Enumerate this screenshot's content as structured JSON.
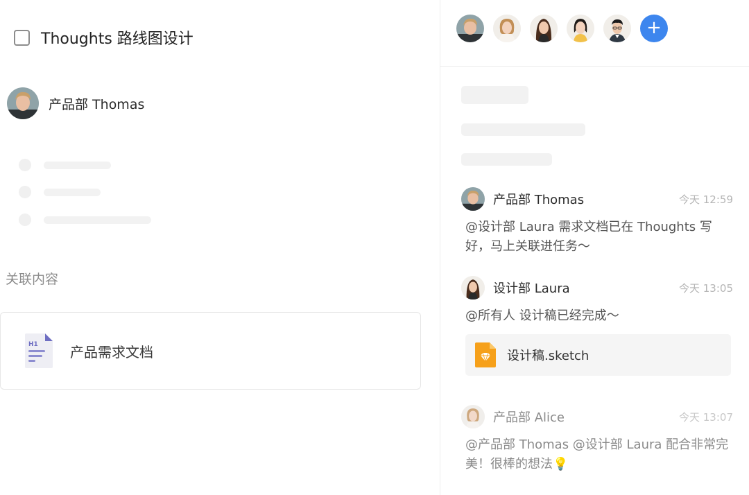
{
  "task": {
    "title": "Thoughts 路线图设计",
    "checked": false,
    "assignee": "产品部 Thomas"
  },
  "related": {
    "label": "关联内容",
    "items": [
      {
        "title": "产品需求文档",
        "icon": "h1-document-icon"
      }
    ]
  },
  "members": {
    "avatars": [
      "avatar-thomas",
      "avatar-alice",
      "avatar-laura",
      "avatar-member-4",
      "avatar-member-5"
    ],
    "add_icon": "+"
  },
  "messages": [
    {
      "author": "产品部 Thomas",
      "time": "今天 12:59",
      "text": "@设计部 Laura 需求文档已在 Thoughts 写好，马上关联进任务～"
    },
    {
      "author": "设计部 Laura",
      "time": "今天 13:05",
      "text": "@所有人 设计稿已经完成～",
      "attachment": {
        "name": "设计稿.sketch",
        "icon": "sketch-file-icon"
      }
    },
    {
      "author": "产品部 Alice",
      "time": "今天 13:07",
      "text": "@产品部 Thomas @设计部 Laura 配合非常完美！很棒的想法💡"
    }
  ],
  "colors": {
    "accent": "#3d86ee",
    "attachment_icon": "#f6a01a",
    "doc_icon": "#6e6ec2"
  }
}
